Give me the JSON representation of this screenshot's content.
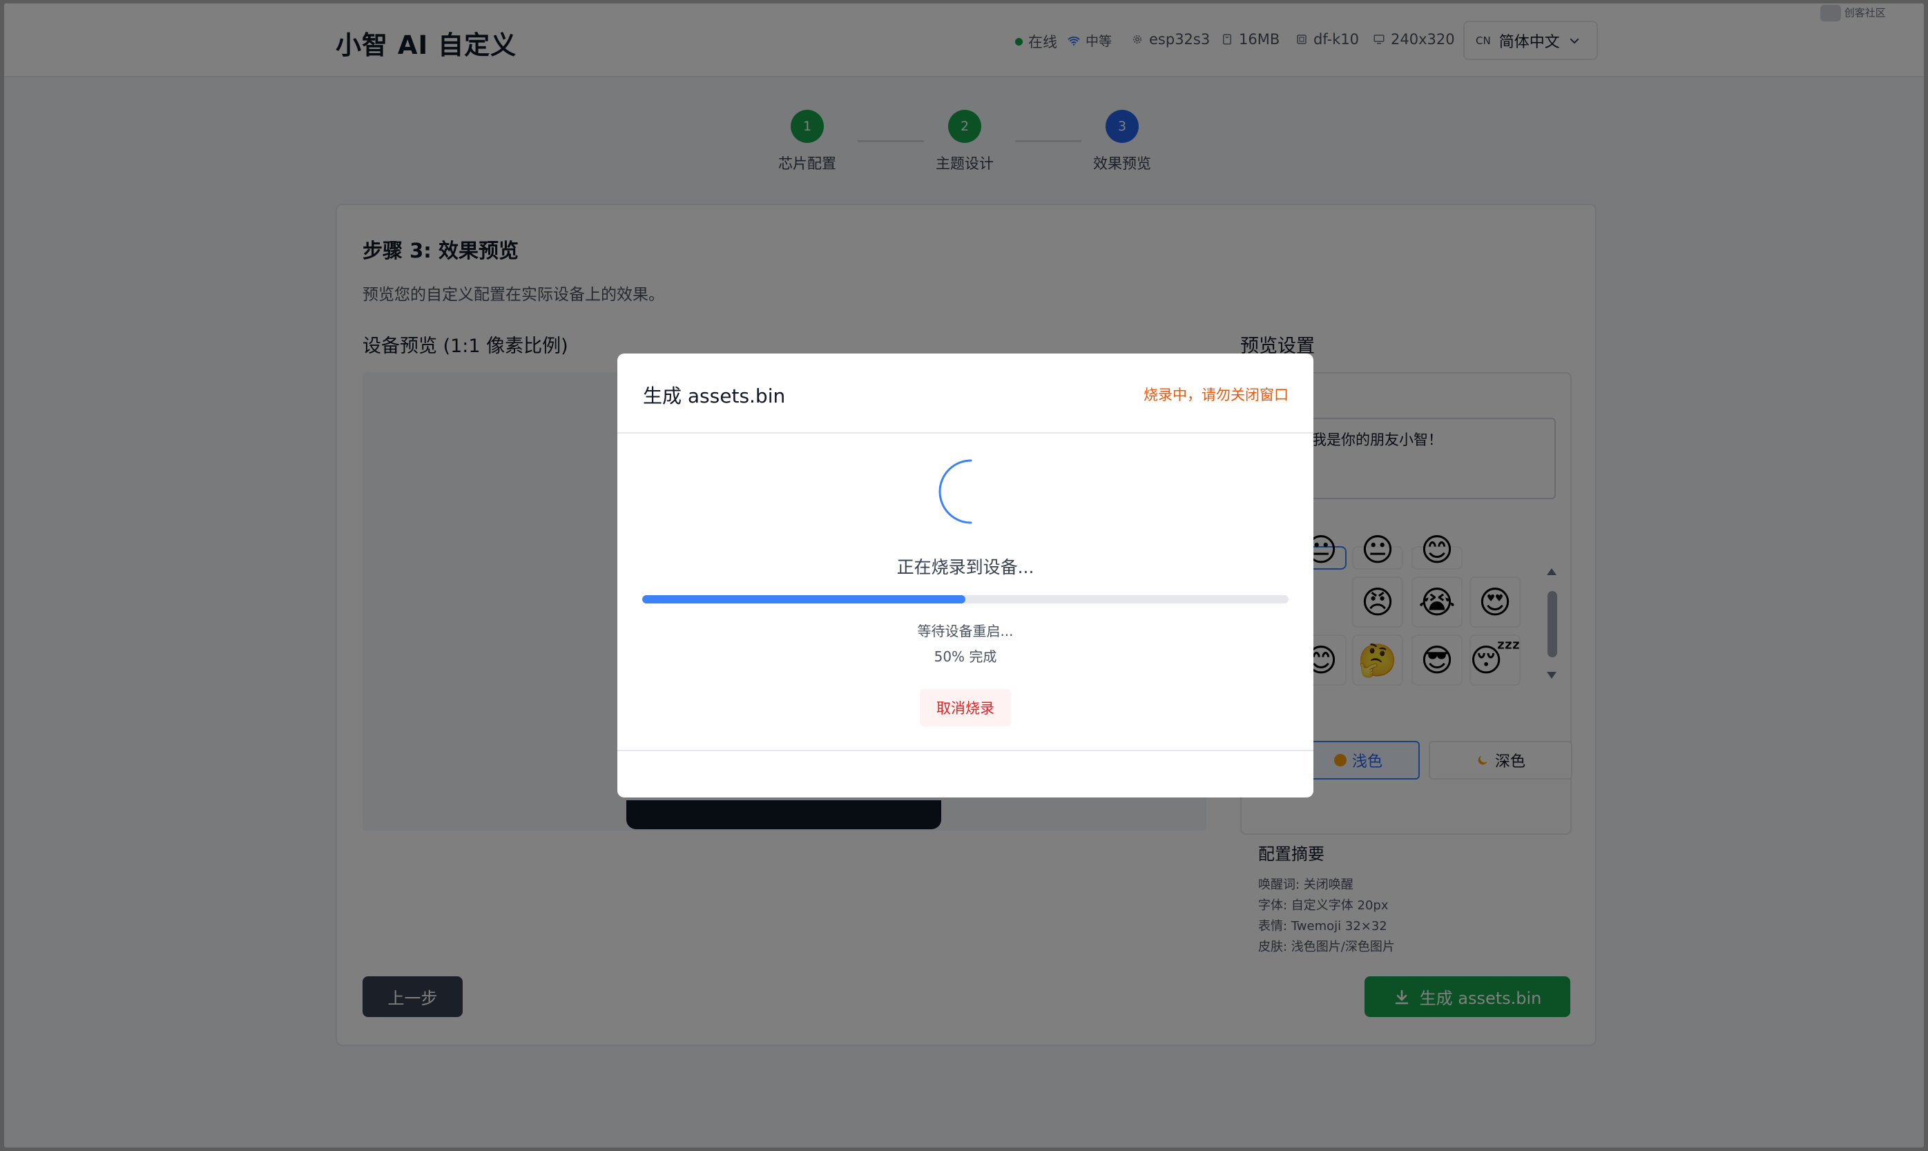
{
  "header": {
    "title": "小智 AI 自定义",
    "status": "在线",
    "signal": "中等",
    "chip": "esp32s3",
    "flash": "16MB",
    "board": "df-k10",
    "resolution": "240x320",
    "language_code": "CN",
    "language": "简体中文",
    "watermark": "创客社区"
  },
  "steps": [
    {
      "number": "1",
      "label": "芯片配置"
    },
    {
      "number": "2",
      "label": "主题设计"
    },
    {
      "number": "3",
      "label": "效果预览"
    }
  ],
  "card": {
    "title": "步骤 3: 效果预览",
    "description": "预览您的自定义配置在实际设备上的效果。",
    "preview_heading": "设备预览 (1:1 像素比例)",
    "settings_heading": "预览设置",
    "greeting_text": "我是你的朋友小智！",
    "emojis": [
      "😐",
      "😐",
      "😊",
      "😠",
      "😭",
      "😍",
      "😊",
      "🤔",
      "😎",
      "😴"
    ],
    "light_label": "浅色",
    "dark_label": "深色",
    "summary": {
      "title": "配置摘要",
      "lines": [
        "唤醒词: 关闭唤醒",
        "字体: 自定义字体 20px",
        "表情: Twemoji 32×32",
        "皮肤: 浅色图片/深色图片"
      ]
    },
    "prev_button": "上一步",
    "generate_button": "生成 assets.bin"
  },
  "modal": {
    "title": "生成 assets.bin",
    "warning": "烧录中，请勿关闭窗口",
    "status": "正在烧录到设备...",
    "progress": 0.5,
    "wait_text": "等待设备重启...",
    "percent_text": "50% 完成",
    "cancel_button": "取消烧录"
  },
  "colors": {
    "step_done": "#16a34a",
    "step_active": "#2563eb",
    "progress": "#3b82f6",
    "warning": "#ea580c",
    "cancel": "#dc2626",
    "generate": "#16a34a"
  }
}
